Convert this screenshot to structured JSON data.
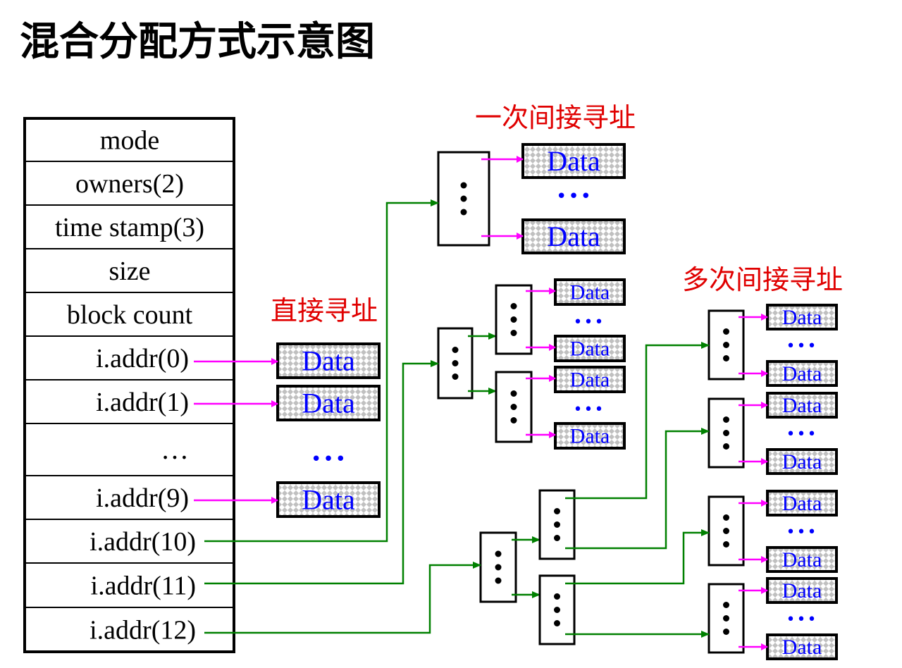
{
  "title": "混合分配方式示意图",
  "labels": {
    "direct": "直接寻址",
    "single_indirect": "一次间接寻址",
    "multi_indirect": "多次间接寻址"
  },
  "inode_fields": [
    "mode",
    "owners(2)",
    "time stamp(3)",
    "size",
    "block count",
    "i.addr(0)",
    "i.addr(1)",
    "…",
    "i.addr(9)",
    "i.addr(10)",
    "i.addr(11)",
    "i.addr(12)"
  ],
  "data_label": "Data",
  "ellipsis": "•••",
  "colors": {
    "pointer_arrow": "#ff00ff",
    "index_arrow": "#008000",
    "data_text": "#0000ff",
    "label_text": "#e00000",
    "data_fill": "#c0c0c0"
  }
}
